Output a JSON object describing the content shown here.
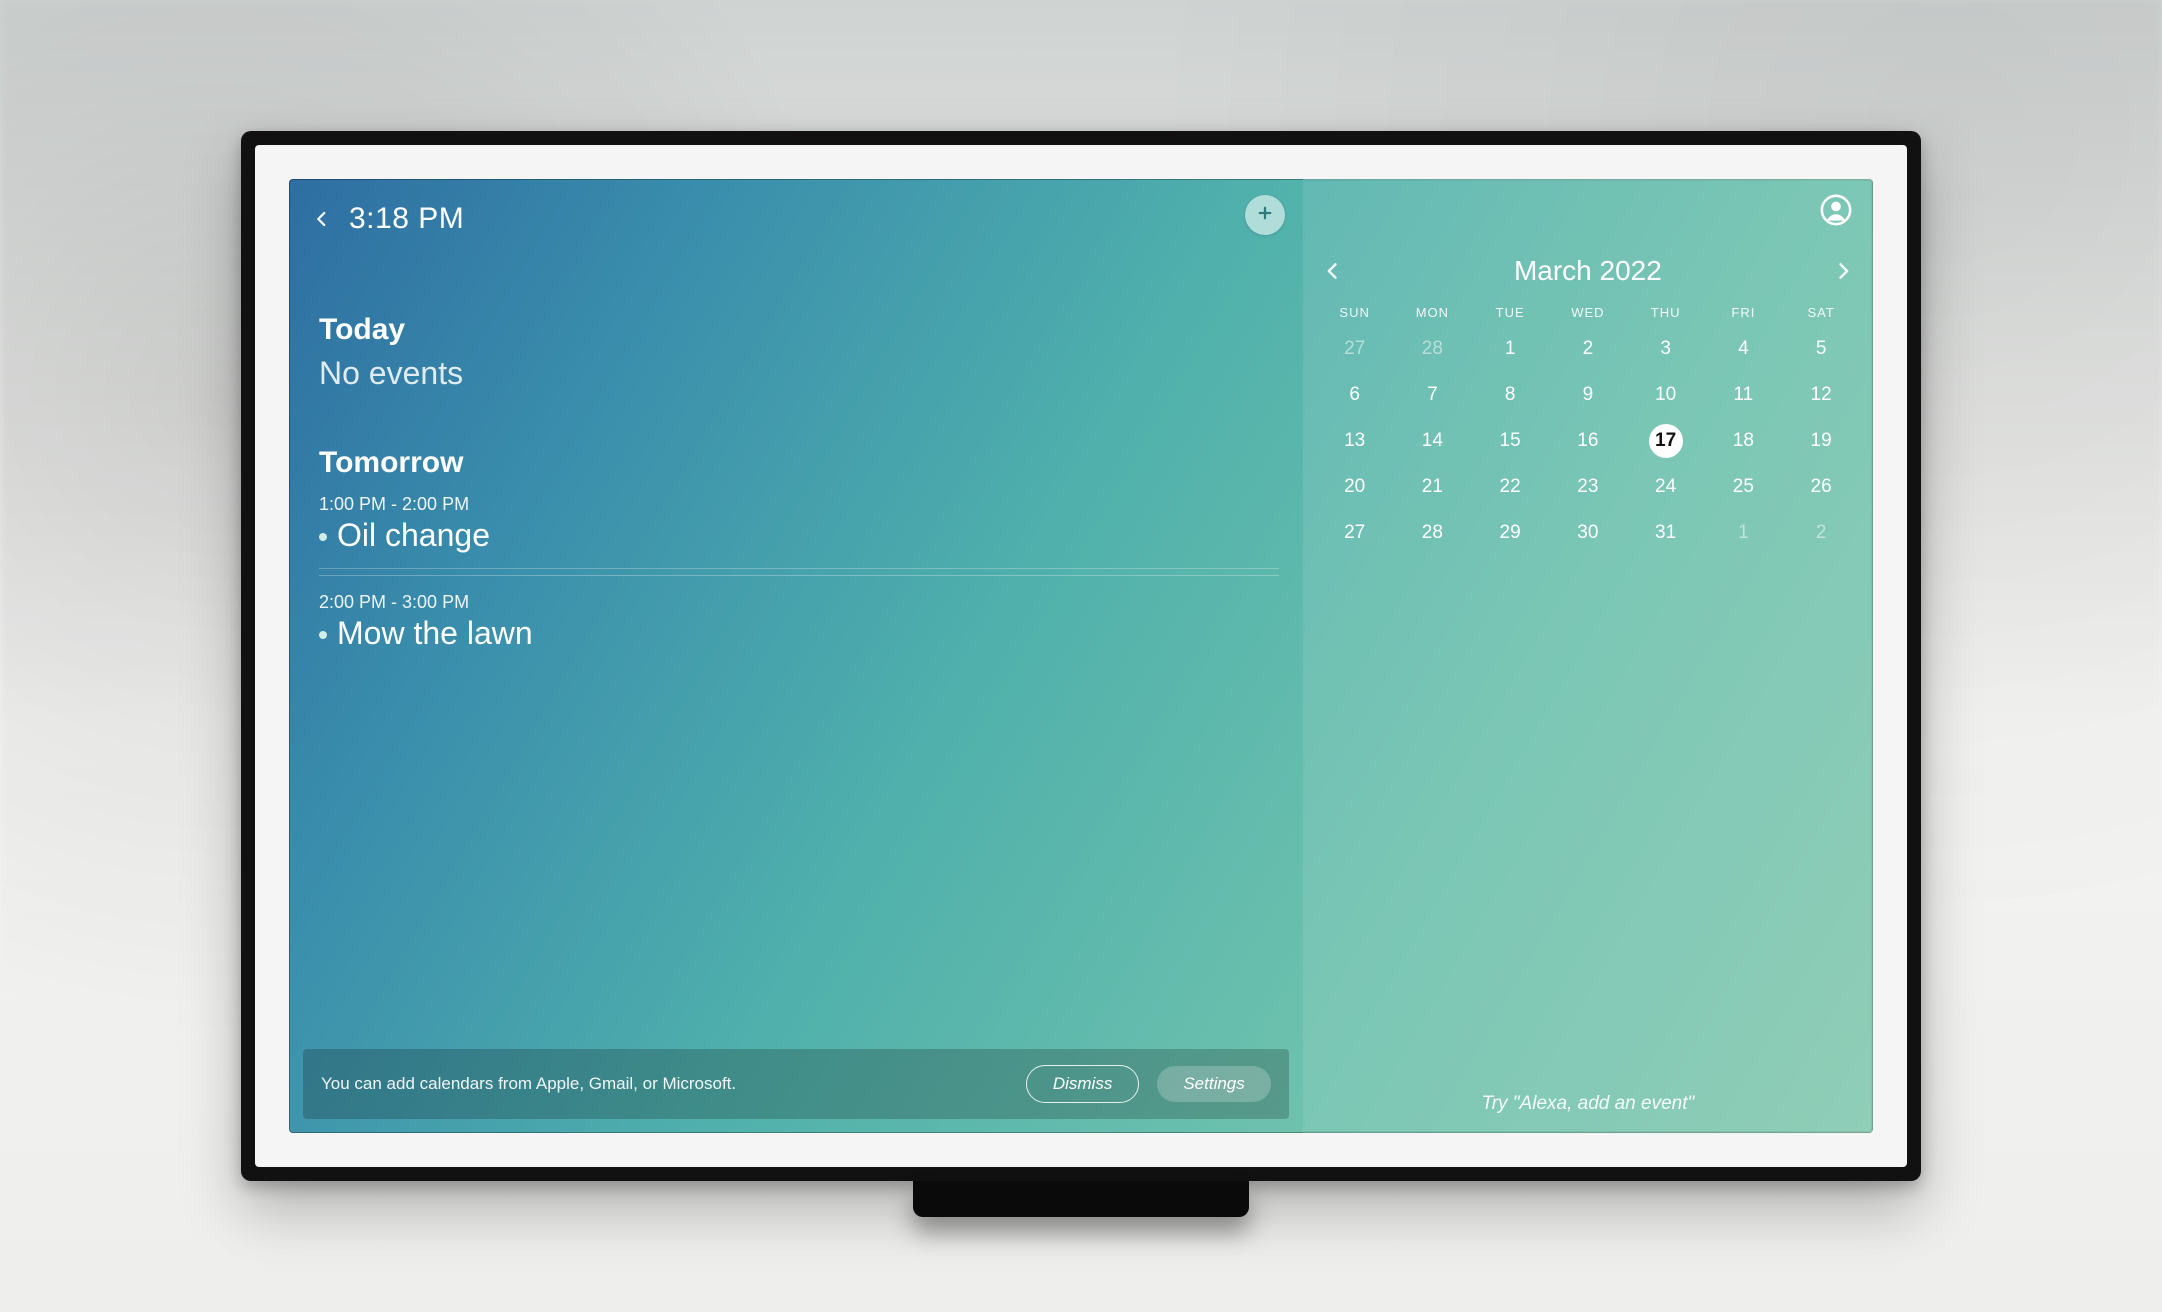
{
  "header": {
    "time": "3:18 PM"
  },
  "agenda": {
    "today_label": "Today",
    "today_empty": "No events",
    "tomorrow_label": "Tomorrow",
    "events": [
      {
        "time": "1:00 PM - 2:00 PM",
        "title": "Oil change"
      },
      {
        "time": "2:00 PM - 3:00 PM",
        "title": "Mow the lawn"
      }
    ]
  },
  "banner": {
    "text": "You can add calendars from Apple, Gmail, or Microsoft.",
    "dismiss": "Dismiss",
    "settings": "Settings"
  },
  "calendar": {
    "month_label": "March 2022",
    "dow": [
      "SUN",
      "MON",
      "TUE",
      "WED",
      "THU",
      "FRI",
      "SAT"
    ],
    "weeks": [
      [
        {
          "d": "27",
          "dim": true
        },
        {
          "d": "28",
          "dim": true
        },
        {
          "d": "1"
        },
        {
          "d": "2"
        },
        {
          "d": "3"
        },
        {
          "d": "4"
        },
        {
          "d": "5"
        }
      ],
      [
        {
          "d": "6"
        },
        {
          "d": "7"
        },
        {
          "d": "8"
        },
        {
          "d": "9"
        },
        {
          "d": "10"
        },
        {
          "d": "11"
        },
        {
          "d": "12"
        }
      ],
      [
        {
          "d": "13"
        },
        {
          "d": "14"
        },
        {
          "d": "15"
        },
        {
          "d": "16"
        },
        {
          "d": "17",
          "today": true
        },
        {
          "d": "18"
        },
        {
          "d": "19"
        }
      ],
      [
        {
          "d": "20"
        },
        {
          "d": "21"
        },
        {
          "d": "22"
        },
        {
          "d": "23"
        },
        {
          "d": "24"
        },
        {
          "d": "25"
        },
        {
          "d": "26"
        }
      ],
      [
        {
          "d": "27"
        },
        {
          "d": "28"
        },
        {
          "d": "29"
        },
        {
          "d": "30"
        },
        {
          "d": "31"
        },
        {
          "d": "1",
          "dim": true
        },
        {
          "d": "2",
          "dim": true
        }
      ]
    ],
    "hint": "Try \"Alexa, add an event\""
  }
}
